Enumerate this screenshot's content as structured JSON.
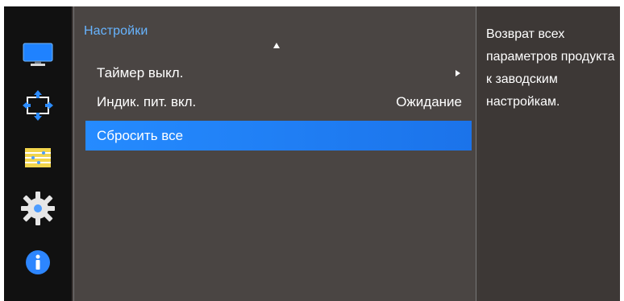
{
  "sidebar": {
    "icons": [
      {
        "name": "display-icon"
      },
      {
        "name": "position-icon"
      },
      {
        "name": "settings-list-icon"
      },
      {
        "name": "gear-icon"
      },
      {
        "name": "info-icon"
      }
    ]
  },
  "menu": {
    "title": "Настройки",
    "items": [
      {
        "label": "Таймер выкл.",
        "value": "",
        "has_submenu": true
      },
      {
        "label": "Индик. пит. вкл.",
        "value": "Ожидание",
        "has_submenu": false
      },
      {
        "label": "Сбросить все",
        "value": "",
        "selected": true
      }
    ]
  },
  "help": {
    "text": "Возврат всех параметров продукта к заводским настройкам."
  },
  "colors": {
    "accent": "#1b73ea",
    "title_text": "#67b4ff",
    "panel_bg": "#4a4543",
    "sidebar_bg": "#111111"
  }
}
